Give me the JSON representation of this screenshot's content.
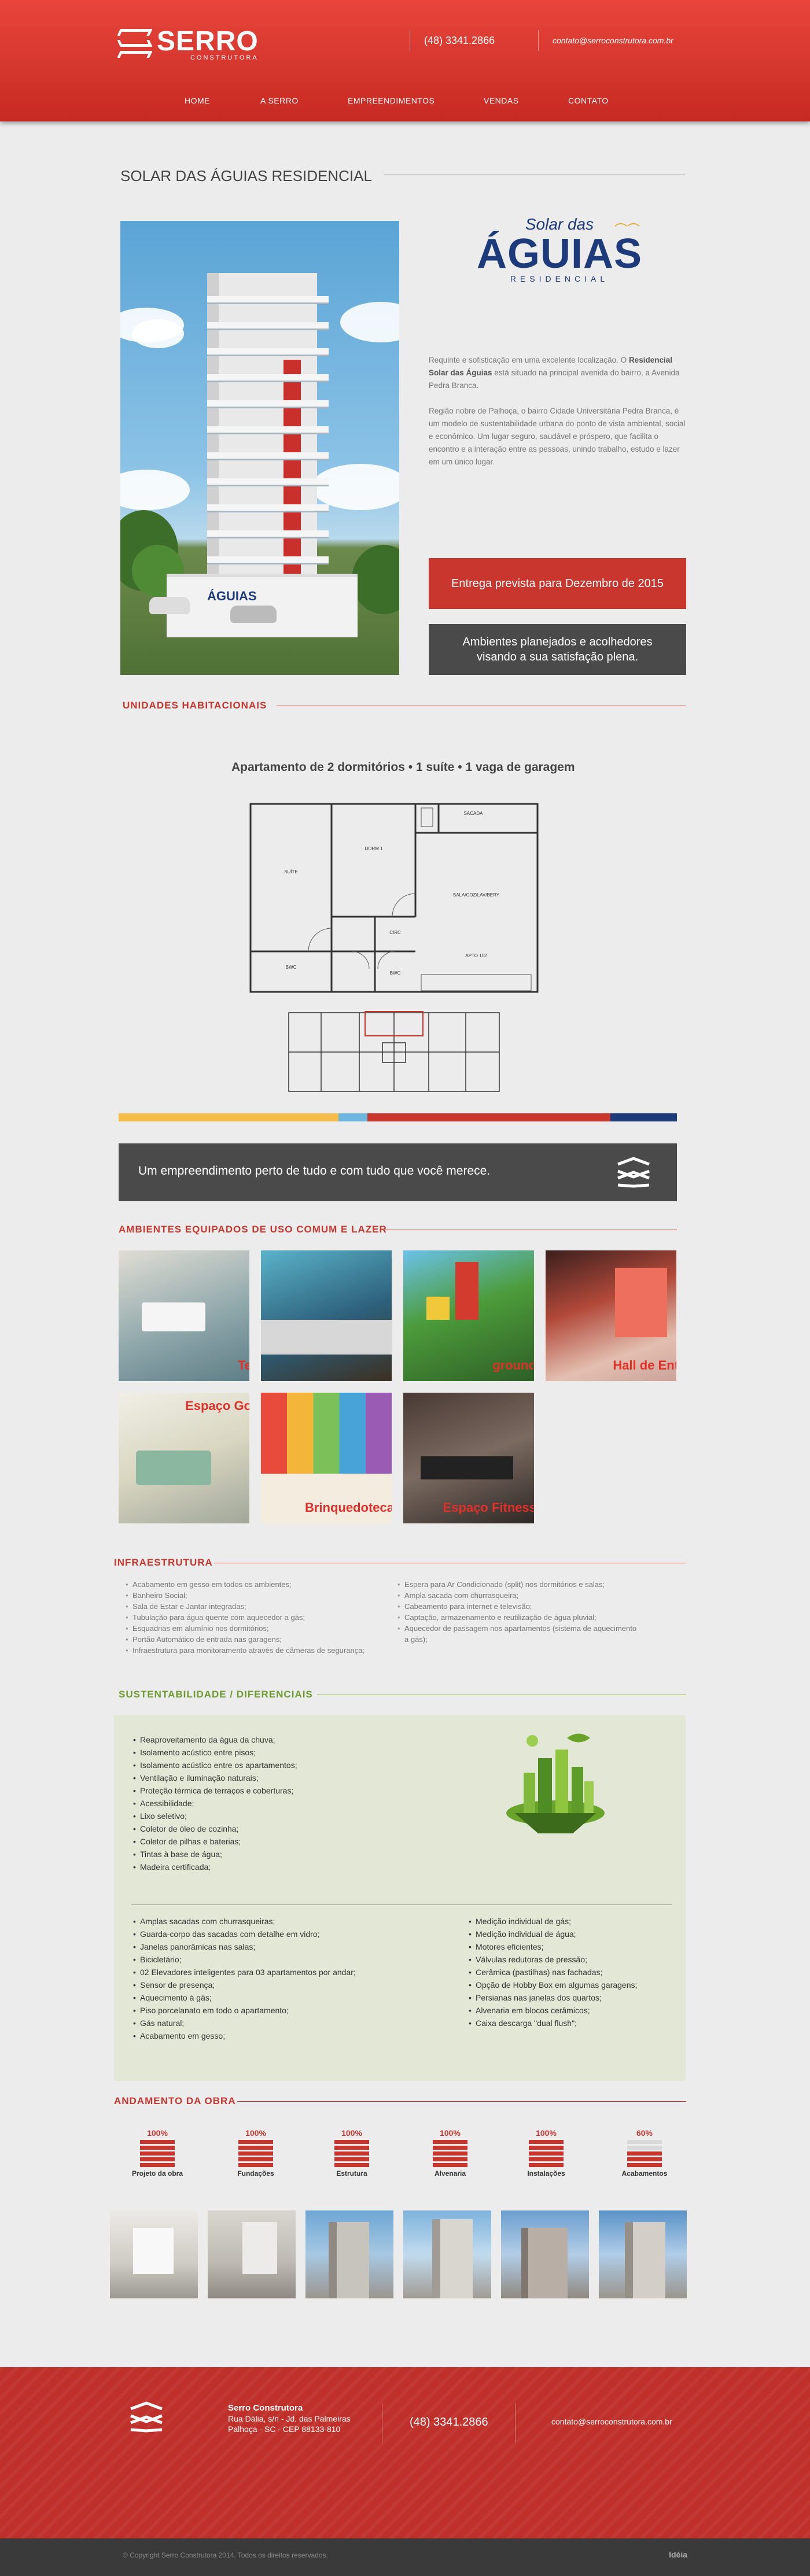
{
  "header": {
    "logo_name": "SERRO",
    "logo_sub": "CONSTRUTORA",
    "phone": "(48) 3341.2866",
    "email": "contato@serroconstrutora.com.br",
    "nav": [
      "HOME",
      "A SERRO",
      "EMPREENDIMENTOS",
      "VENDAS",
      "CONTATO"
    ]
  },
  "page": {
    "title": "SOLAR DAS ÁGUIAS RESIDENCIAL"
  },
  "brand": {
    "top": "Solar das",
    "main": "ÁGUIAS",
    "sub": "RESIDENCIAL"
  },
  "hero_render": {
    "sign": "ÁGUIAS"
  },
  "description": {
    "p1_before": "Requinte e sofisticação em uma excelente localização. O ",
    "p1_strong": "Residencial Solar das Águias",
    "p1_after": " está situado na principal avenida do bairro, a Avenida Pedra Branca.",
    "p2": "Região nobre de Palhoça, o bairro Cidade Universitária Pedra Branca, é um modelo de sustentabilidade urbana do ponto de vista ambiental, social e econômico. Um lugar seguro, saudável e próspero, que facilita o encontro e a interação entre as pessoas, unindo trabalho, estudo e lazer em um único lugar."
  },
  "boxes": {
    "delivery": "Entrega prevista para Dezembro de 2015",
    "ambient_line1": "Ambientes planejados e acolhedores",
    "ambient_line2": "visando a sua satisfação plena."
  },
  "sections": {
    "units": "UNIDADES HABITACIONAIS",
    "leisure": "AMBIENTES EQUIPADOS DE USO COMUM E LAZER",
    "infra": "INFRAESTRUTURA",
    "sust": "SUSTENTABILIDADE / DIFERENCIAIS",
    "progress": "ANDAMENTO DA OBRA"
  },
  "apartment": {
    "title": "Apartamento de 2 dormitórios • 1 suíte  • 1 vaga de garagem",
    "rooms": [
      "SACADA",
      "DORM 1",
      "SUÍTE",
      "SALA/COZ/LAV/BERY",
      "CIRC",
      "BWC",
      "BWC",
      "APTO 102"
    ]
  },
  "banner": {
    "text": "Um empreendimento perto de tudo e com tudo que você merece."
  },
  "colors": {
    "brand_red": "#c8362e",
    "dark": "#4a4a4a",
    "green": "#7da23c",
    "bar": [
      "#f6bd4a",
      "#6cb6e0",
      "#c8362e",
      "#1d3b7a"
    ]
  },
  "gallery": [
    {
      "caption": "Te"
    },
    {
      "caption": ""
    },
    {
      "caption": "ground"
    },
    {
      "caption": "Hall de Ent"
    },
    {
      "caption": "Espaço Go"
    },
    {
      "caption": "Brinquedoteca"
    },
    {
      "caption": "Espaço Fitness"
    }
  ],
  "infra": {
    "left": [
      "Acabamento em gesso em todos os ambientes;",
      "Banheiro Social;",
      "Sala de Estar e Jantar integradas;",
      "Tubulação para água quente com aquecedor a gás;",
      "Esquadrias em alumínio nos dormitórios;",
      "Portão Automático de entrada nas garagens;",
      "Infraestrutura para monitoramento através de câmeras de segurança;"
    ],
    "right": [
      "Espera para Ar Condicionado (split) nos dormitórios e salas;",
      "Ampla sacada com churrasqueira;",
      "Cabeamento para internet e televisão;",
      "Captação, armazenamento e reutilização de água pluvial;",
      "Aquecedor de passagem nos apartamentos (sistema de aquecimento a gás);"
    ]
  },
  "sust": {
    "top": [
      "Reaproveitamento da água da chuva;",
      "Isolamento acústico entre pisos;",
      "Isolamento acústico entre os apartamentos;",
      "Ventilação e iluminação naturais;",
      "Proteção térmica de terraços e coberturas;",
      "Acessibilidade;",
      "Lixo seletivo;",
      "Coletor de óleo de cozinha;",
      "Coletor de pilhas e baterias;",
      "Tintas à base de água;",
      "Madeira certificada;"
    ],
    "bottom_left": [
      "Amplas sacadas com churrasqueiras;",
      "Guarda-corpo das sacadas com detalhe em vidro;",
      "Janelas panorâmicas nas salas;",
      "Bicicletário;",
      "02 Elevadores inteligentes para 03 apartamentos por andar;",
      "Sensor de presença;",
      "Aquecimento à gás;",
      "Piso porcelanato em todo o apartamento;",
      "Gás natural;",
      "Acabamento em gesso;"
    ],
    "bottom_right": [
      "Medição individual de gás;",
      "Medição individual de água;",
      "Motores eficientes;",
      "Válvulas redutoras de pressão;",
      "Cerâmica (pastilhas) nas fachadas;",
      "Opção de Hobby Box em algumas garagens;",
      "Persianas nas janelas dos quartos;",
      "Alvenaria em blocos cerâmicos;",
      "Caixa descarga \"dual flush\";"
    ]
  },
  "progress": [
    {
      "pct": "100%",
      "value": 100,
      "label": "Projeto da obra"
    },
    {
      "pct": "100%",
      "value": 100,
      "label": "Fundações"
    },
    {
      "pct": "100%",
      "value": 100,
      "label": "Estrutura"
    },
    {
      "pct": "100%",
      "value": 100,
      "label": "Alvenaria"
    },
    {
      "pct": "100%",
      "value": 100,
      "label": "Instalações"
    },
    {
      "pct": "60%",
      "value": 60,
      "label": "Acabamentos"
    }
  ],
  "footer": {
    "company": "Serro Construtora",
    "address1": "Rua Dália, s/n - Jd. das Palmeiras",
    "address2": "Palhoça - SC - CEP 88133-810",
    "phone": "(48) 3341.2866",
    "email": "contato@serroconstrutora.com.br",
    "copyright": "© Copyright Serro Construtora 2014. Todos os direitos reservados.",
    "made_by": "Idéia"
  }
}
